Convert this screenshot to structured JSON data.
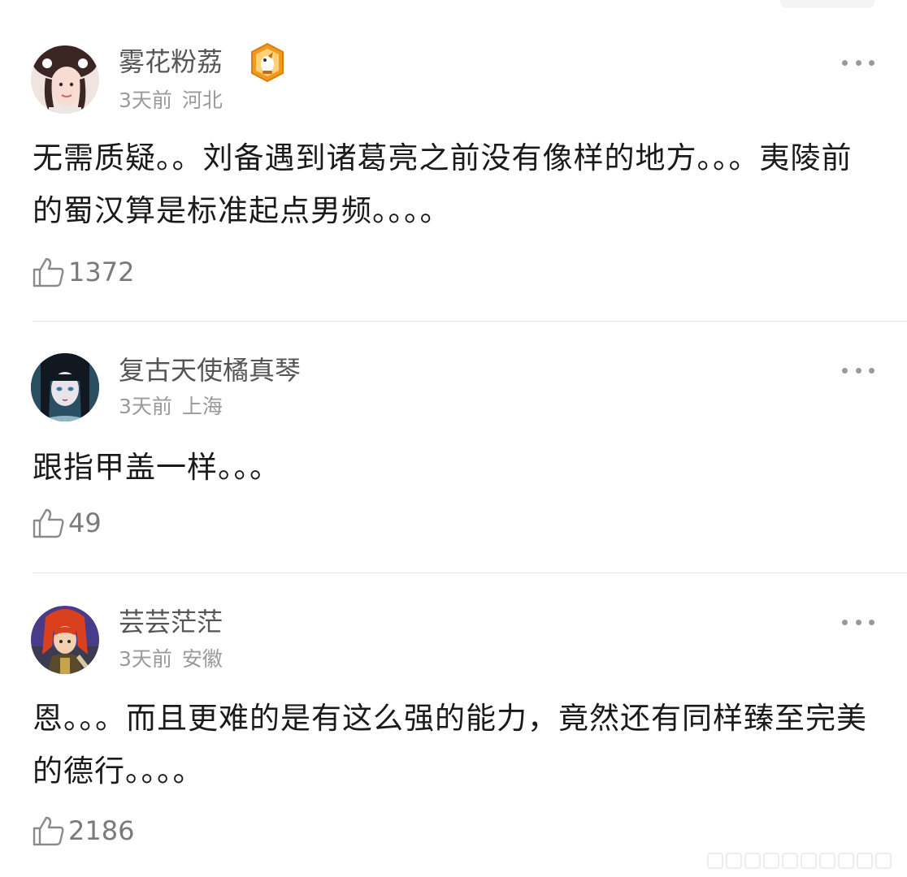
{
  "comments": [
    {
      "username": "雾花粉荔",
      "time": "3天前",
      "location": "河北",
      "text": "无需质疑。。刘备遇到诸葛亮之前没有像样的地方。。。夷陵前的蜀汉算是标准起点男频。。。。",
      "likes": "1372",
      "has_badge": true
    },
    {
      "username": "复古天使橘真琴",
      "time": "3天前",
      "location": "上海",
      "text": "跟指甲盖一样。。。",
      "likes": "49",
      "has_badge": false
    },
    {
      "username": "芸芸茫茫",
      "time": "3天前",
      "location": "安徽",
      "text": "恩。。。而且更难的是有这么强的能力，竟然还有同样臻至完美的德行。。。。",
      "likes": "2186",
      "has_badge": false
    }
  ],
  "icons": {
    "like": "thumbs-up-icon",
    "more": "more-dots-icon",
    "badge": "medal-badge-icon"
  },
  "colors": {
    "username": "#555555",
    "meta": "#9a9a9a",
    "text": "#1a1a1a",
    "like": "#7a7a7a",
    "badge_orange": "#f29a1f",
    "divider": "#e6e6e6"
  }
}
